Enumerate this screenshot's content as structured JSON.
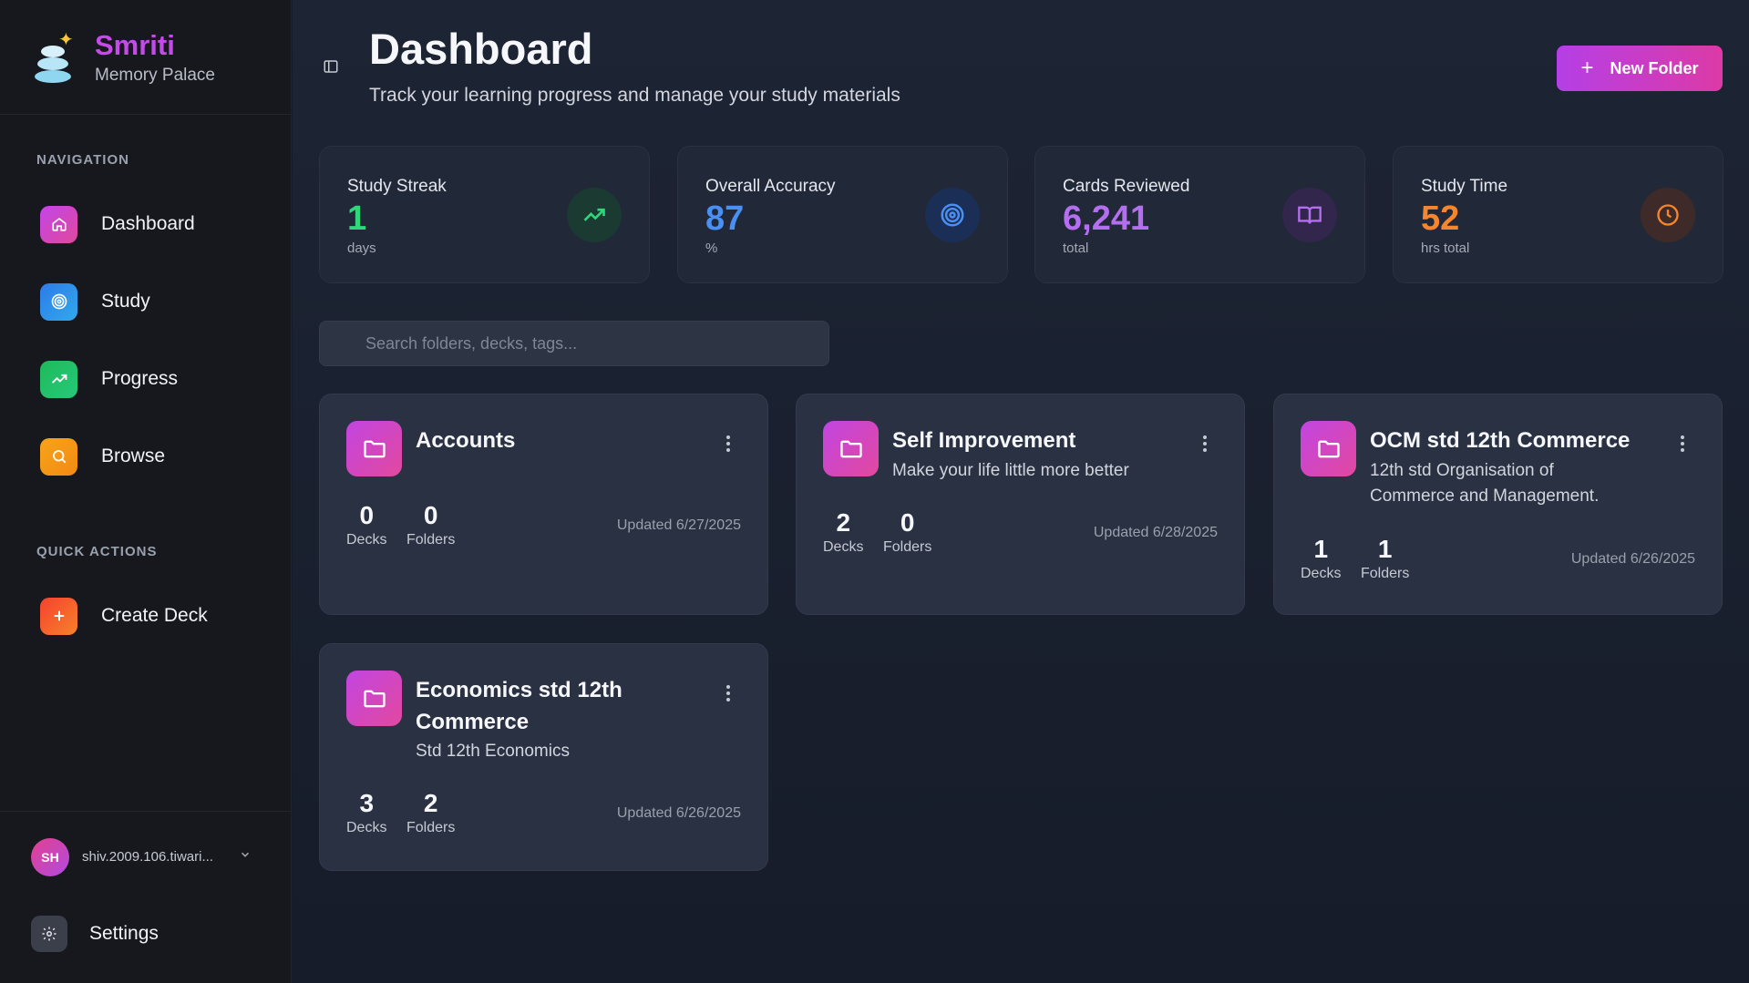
{
  "brand": {
    "name": "Smriti",
    "subtitle": "Memory Palace"
  },
  "sidebar": {
    "nav_title": "NAVIGATION",
    "nav": [
      {
        "label": "Dashboard",
        "icon": "home-icon",
        "color": "#c646e6"
      },
      {
        "label": "Study",
        "icon": "target-icon",
        "color": "#2f86ec"
      },
      {
        "label": "Progress",
        "icon": "trend-up-icon",
        "color": "#22c462"
      },
      {
        "label": "Browse",
        "icon": "search-icon",
        "color": "#f59b14"
      }
    ],
    "quick_title": "QUICK ACTIONS",
    "quick": [
      {
        "label": "Create Deck",
        "icon": "plus-icon",
        "color": "#f25c2e"
      }
    ],
    "user": {
      "initials": "SH",
      "email": "shiv.2009.106.tiwari..."
    },
    "settings_label": "Settings"
  },
  "header": {
    "title": "Dashboard",
    "subtitle": "Track your learning progress and manage your study materials",
    "new_folder_label": "New Folder"
  },
  "stats": [
    {
      "label": "Study Streak",
      "value": "1",
      "unit": "days",
      "color": "#2ed87a",
      "icon": "trend-up-icon",
      "icon_bg": "#1b3a32"
    },
    {
      "label": "Overall Accuracy",
      "value": "87",
      "unit": "%",
      "color": "#4a8ff2",
      "icon": "target-icon",
      "icon_bg": "#1b2e55"
    },
    {
      "label": "Cards Reviewed",
      "value": "6,241",
      "unit": "total",
      "color": "#b46ef0",
      "icon": "book-icon",
      "icon_bg": "#33264d"
    },
    {
      "label": "Study Time",
      "value": "52",
      "unit": "hrs total",
      "color": "#f5862e",
      "icon": "clock-icon",
      "icon_bg": "#3f2a2a"
    }
  ],
  "search": {
    "placeholder": "Search folders, decks, tags..."
  },
  "folders": [
    {
      "title": "Accounts",
      "description": "",
      "decks": "0",
      "folders": "0",
      "decks_label": "Decks",
      "folders_label": "Folders",
      "updated": "Updated 6/27/2025"
    },
    {
      "title": "Self Improvement",
      "description": "Make your life little more better",
      "decks": "2",
      "folders": "0",
      "decks_label": "Decks",
      "folders_label": "Folders",
      "updated": "Updated 6/28/2025"
    },
    {
      "title": "OCM std 12th Commerce",
      "description": "12th std Organisation of Commerce and Management.",
      "decks": "1",
      "folders": "1",
      "decks_label": "Decks",
      "folders_label": "Folders",
      "updated": "Updated 6/26/2025"
    },
    {
      "title": "Economics std 12th Commerce",
      "description": "Std 12th Economics",
      "decks": "3",
      "folders": "2",
      "decks_label": "Decks",
      "folders_label": "Folders",
      "updated": "Updated 6/26/2025"
    }
  ]
}
